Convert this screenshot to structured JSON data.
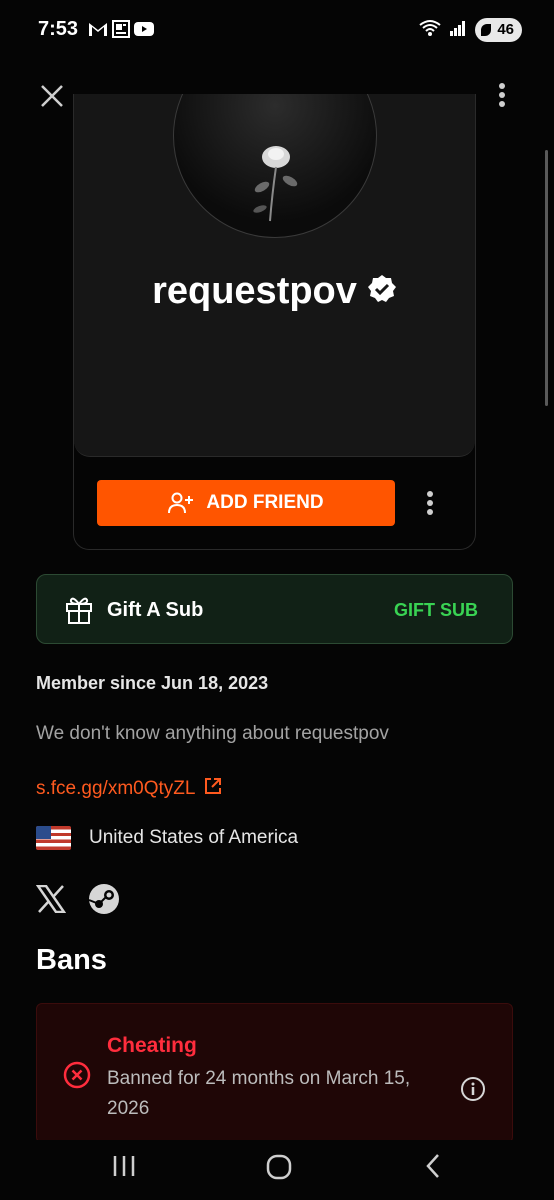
{
  "status_bar": {
    "time": "7:53",
    "battery": "46",
    "notification_icons": [
      "gmail-icon",
      "news-icon",
      "youtube-icon"
    ],
    "system_icons": [
      "wifi-icon",
      "signal-icon",
      "battery-icon"
    ]
  },
  "profile": {
    "username": "requestpov",
    "verified": true,
    "add_friend_label": "ADD FRIEND"
  },
  "gift": {
    "title": "Gift A Sub",
    "button_label": "GIFT SUB"
  },
  "about": {
    "member_since": "Member since Jun 18, 2023",
    "bio": "We don't know anything about requestpov",
    "link": "s.fce.gg/xm0QtyZL",
    "country": "United States of America",
    "socials": [
      "x-icon",
      "steam-icon"
    ]
  },
  "bans": {
    "heading": "Bans",
    "items": [
      {
        "type": "Cheating",
        "description": "Banned for 24 months on March 15, 2026"
      }
    ]
  },
  "colors": {
    "accent": "#ff5500",
    "gift_green": "#39d353",
    "ban_red": "#ff2d3d",
    "background": "#050505"
  }
}
